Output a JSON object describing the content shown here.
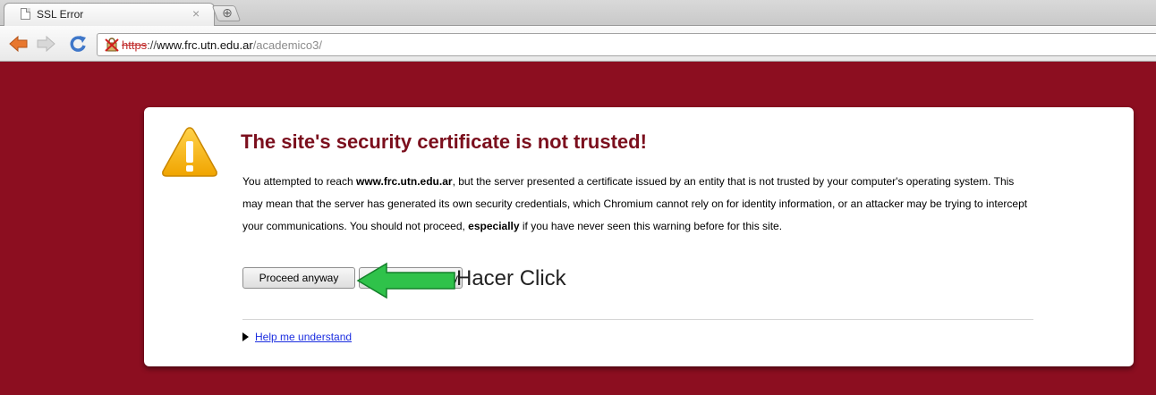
{
  "tab": {
    "title": "SSL Error",
    "close_glyph": "×",
    "newtab_glyph": "⊕"
  },
  "toolbar": {
    "back_icon": "back-arrow-icon",
    "forward_icon": "forward-arrow-icon",
    "reload_icon": "reload-icon"
  },
  "omnibox": {
    "scheme": "https",
    "separator": "://",
    "host": "www.frc.utn.edu.ar",
    "path": "/academico3/",
    "security_icon": "broken-lock-icon"
  },
  "interstitial": {
    "heading": "The site's security certificate is not trusted!",
    "body": {
      "p1": "You attempted to reach ",
      "host_bold": "www.frc.utn.edu.ar",
      "p2": ", but the server presented a certificate issued by an entity that is not trusted by your computer's operating system. This may mean that the server has generated its own security credentials, which Chromium cannot rely on for identity information, or an attacker may be trying to intercept your communications. You should not proceed, ",
      "emphasis_bold": "especially",
      "p3": " if you have never seen this warning before for this site."
    },
    "proceed_label": "Proceed anyway",
    "back_label_visible": "y",
    "help_label": "Help me understand"
  },
  "annotation": {
    "text": "Hacer Click",
    "arrow_color": "#2fc24a"
  },
  "colors": {
    "page_background": "#8c0e20",
    "heading": "#7b0f1d",
    "link": "#1c2ee0",
    "warning_fill": "#f5b400"
  }
}
